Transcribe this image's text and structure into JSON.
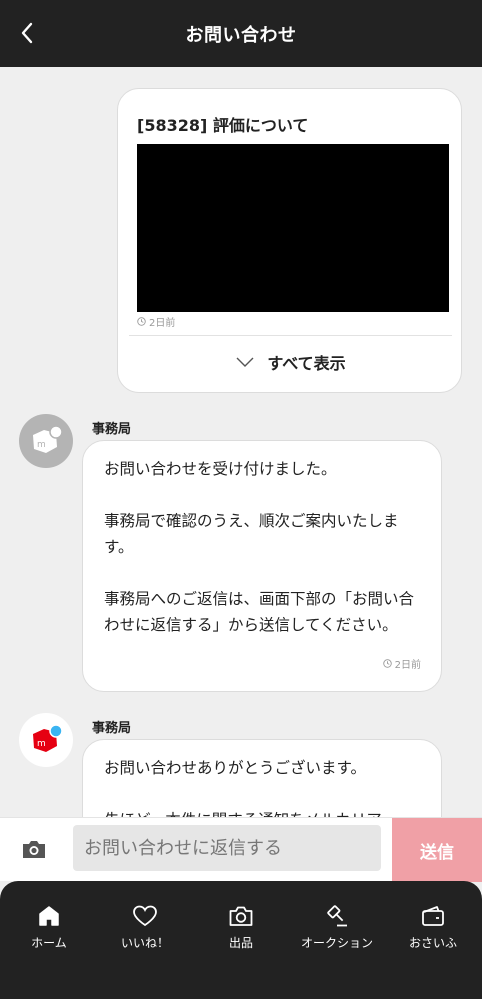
{
  "header": {
    "title": "お問い合わせ"
  },
  "card": {
    "title": "[58328] 評価について",
    "time": "2日前",
    "show_all": "すべて表示"
  },
  "messages": [
    {
      "sender": "事務局",
      "paragraphs": [
        "お問い合わせを受け付けました。",
        "事務局で確認のうえ、順次ご案内いたします。",
        "事務局へのご返信は、画面下部の「お問い合わせに返信する」から送信してください。"
      ],
      "time": "2日前"
    },
    {
      "sender": "事務局",
      "paragraphs": [
        "お問い合わせありがとうございます。",
        "先ほど、本件に関する通知をメルカリア"
      ]
    }
  ],
  "reply": {
    "placeholder": "お問い合わせに返信する",
    "send_label": "送信"
  },
  "tabs": [
    {
      "label": "ホーム",
      "icon": "home-icon"
    },
    {
      "label": "いいね！",
      "icon": "heart-icon"
    },
    {
      "label": "出品",
      "icon": "camera-icon"
    },
    {
      "label": "オークション",
      "icon": "gavel-icon"
    },
    {
      "label": "おさいふ",
      "icon": "wallet-icon"
    }
  ],
  "colors": {
    "header_bg": "#222222",
    "send_button": "#f0a0a6",
    "brand_red": "#e60012",
    "brand_blue": "#3ab4f2"
  }
}
